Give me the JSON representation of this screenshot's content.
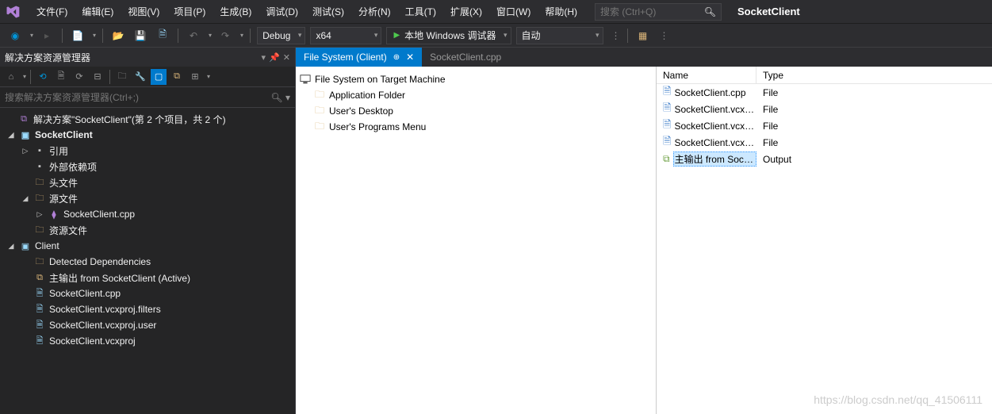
{
  "menu": {
    "items": [
      "文件(F)",
      "编辑(E)",
      "视图(V)",
      "项目(P)",
      "生成(B)",
      "调试(D)",
      "测试(S)",
      "分析(N)",
      "工具(T)",
      "扩展(X)",
      "窗口(W)",
      "帮助(H)"
    ],
    "search_placeholder": "搜索 (Ctrl+Q)",
    "project_name": "SocketClient"
  },
  "toolbar": {
    "config": "Debug",
    "platform": "x64",
    "start_label": "本地 Windows 调试器",
    "auto_label": "自动"
  },
  "solution_panel": {
    "title": "解决方案资源管理器",
    "search_placeholder": "搜索解决方案资源管理器(Ctrl+;)",
    "solution_label": "解决方案\"SocketClient\"(第 2 个项目，共 2 个)",
    "tree": [
      {
        "depth": 0,
        "exp": "◢",
        "icon": "proj",
        "label": "SocketClient",
        "bold": true
      },
      {
        "depth": 1,
        "exp": "▷",
        "icon": "ref",
        "label": "引用"
      },
      {
        "depth": 1,
        "exp": "",
        "icon": "ref",
        "label": "外部依赖项"
      },
      {
        "depth": 1,
        "exp": "",
        "icon": "folder",
        "label": "头文件"
      },
      {
        "depth": 1,
        "exp": "◢",
        "icon": "folder",
        "label": "源文件"
      },
      {
        "depth": 2,
        "exp": "▷",
        "icon": "cpp",
        "label": "SocketClient.cpp"
      },
      {
        "depth": 1,
        "exp": "",
        "icon": "folder",
        "label": "资源文件"
      },
      {
        "depth": 0,
        "exp": "◢",
        "icon": "proj",
        "label": "Client"
      },
      {
        "depth": 1,
        "exp": "",
        "icon": "folder",
        "label": "Detected Dependencies"
      },
      {
        "depth": 1,
        "exp": "",
        "icon": "out",
        "label": "主输出 from SocketClient (Active)"
      },
      {
        "depth": 1,
        "exp": "",
        "icon": "file",
        "label": "SocketClient.cpp"
      },
      {
        "depth": 1,
        "exp": "",
        "icon": "file",
        "label": "SocketClient.vcxproj.filters"
      },
      {
        "depth": 1,
        "exp": "",
        "icon": "file",
        "label": "SocketClient.vcxproj.user"
      },
      {
        "depth": 1,
        "exp": "",
        "icon": "file",
        "label": "SocketClient.vcxproj"
      }
    ]
  },
  "tabs": {
    "active": "File System (Client)",
    "inactive": "SocketClient.cpp"
  },
  "filesystem": {
    "root": "File System on Target Machine",
    "folders": [
      "Application Folder",
      "User's Desktop",
      "User's Programs Menu"
    ],
    "columns": {
      "name": "Name",
      "type": "Type"
    },
    "items": [
      {
        "name": "SocketClient.cpp",
        "type": "File",
        "icon": "doc"
      },
      {
        "name": "SocketClient.vcxpr...",
        "type": "File",
        "icon": "doc"
      },
      {
        "name": "SocketClient.vcxpr...",
        "type": "File",
        "icon": "doc"
      },
      {
        "name": "SocketClient.vcxpr...",
        "type": "File",
        "icon": "doc"
      },
      {
        "name": "主输出 from Sock...",
        "type": "Output",
        "icon": "out",
        "selected": true
      }
    ]
  },
  "watermark": "https://blog.csdn.net/qq_41506111"
}
